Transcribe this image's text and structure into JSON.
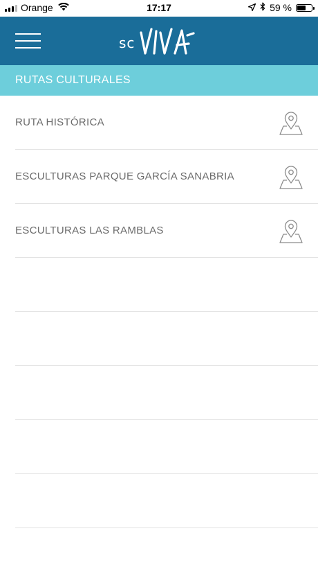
{
  "status_bar": {
    "carrier": "Orange",
    "time": "17:17",
    "battery": "59 %",
    "battery_level": 0.59,
    "icons": [
      "signal-icon",
      "wifi-icon",
      "location-arrow-icon",
      "bluetooth-icon",
      "battery-icon"
    ]
  },
  "header": {
    "logo_prefix": "sc",
    "logo_word": "VIVA",
    "menu_icon": "hamburger-menu-icon",
    "background_color": "#1a6d99"
  },
  "section": {
    "title": "RUTAS CULTURALES",
    "background_color": "#6dcedb"
  },
  "routes": [
    {
      "label": "RUTA HISTÓRICA",
      "icon": "map-pin-icon"
    },
    {
      "label": "ESCULTURAS PARQUE GARCÍA SANABRIA",
      "icon": "map-pin-icon"
    },
    {
      "label": "ESCULTURAS LAS RAMBLAS",
      "icon": "map-pin-icon"
    }
  ]
}
